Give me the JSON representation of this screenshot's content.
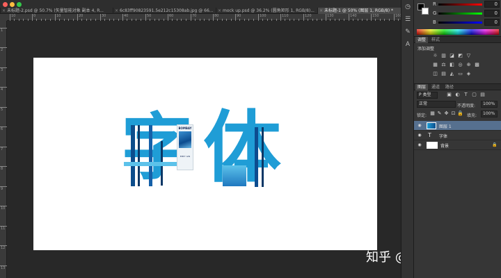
{
  "tabs": [
    {
      "label": "未标题-2.psd @ 50.7% (矢量智能对象 副本 4, R...",
      "active": false
    },
    {
      "label": "6c83ff90823591.5e212c15308ab.jpg @ 66...",
      "active": false
    },
    {
      "label": "mock up.psd @ 36.2% (圆角矩形 1, RGB/8)...",
      "active": false
    },
    {
      "label": "未标题-1 @ 50% (图层 1, RGB/8) *",
      "active": true
    }
  ],
  "ruler": {
    "top_labels": [
      "10",
      "0",
      "10",
      "20",
      "30",
      "40",
      "50",
      "60",
      "70",
      "80",
      "90",
      "100",
      "110",
      "120",
      "130",
      "140",
      "150",
      "160"
    ],
    "left_labels": [
      "1",
      "2",
      "3",
      "4",
      "5",
      "6",
      "7",
      "8",
      "9",
      "10",
      "11",
      "12",
      "13"
    ]
  },
  "canvas": {
    "artwork_text": [
      "字",
      "体"
    ],
    "poster_texts": [
      "BOMBAY",
      "EMPY GIN"
    ]
  },
  "watermark": "知乎 @加糖的小鹿",
  "color_panel": {
    "channels": [
      {
        "label": "R",
        "value": "0"
      },
      {
        "label": "G",
        "value": "0"
      },
      {
        "label": "B",
        "value": "0"
      }
    ]
  },
  "adjustments": {
    "tabs": [
      "调整",
      "样式"
    ],
    "title": "添加调整"
  },
  "layers": {
    "tabs": [
      "图层",
      "通道",
      "路径"
    ],
    "filter_label": "P 类型",
    "blend_mode": "正常",
    "opacity_label": "不透明度:",
    "opacity_value": "100%",
    "lock_label": "锁定:",
    "fill_label": "填充:",
    "fill_value": "100%",
    "items": [
      {
        "name": "图层 1",
        "type": "image",
        "selected": true
      },
      {
        "name": "字体",
        "type": "text",
        "selected": false
      },
      {
        "name": "背景",
        "type": "background",
        "selected": false
      }
    ]
  },
  "colors": {
    "accent_blue": "#1f9dd6",
    "selection": "#56708f",
    "canvas": "#ffffff",
    "workspace": "#282828"
  }
}
